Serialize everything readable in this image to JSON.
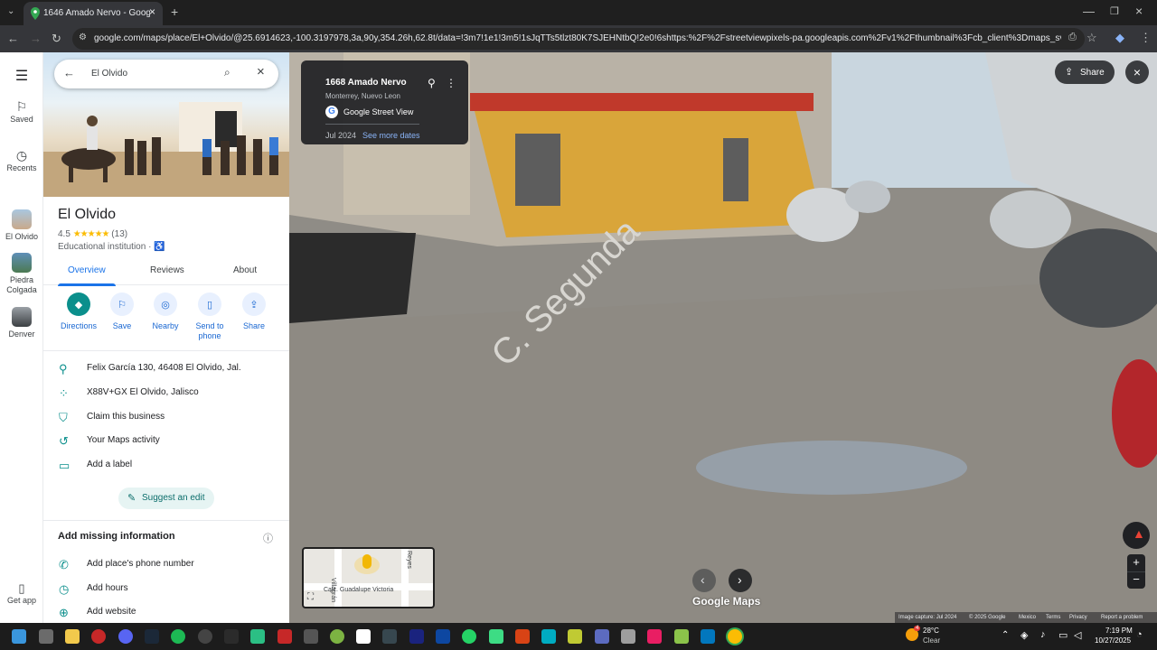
{
  "browser": {
    "tab_title": "1646 Amado Nervo - Google M",
    "url": "google.com/maps/place/El+Olvido/@25.6914623,-100.3197978,3a,90y,354.26h,62.8t/data=!3m7!1e1!3m5!1sJqTTs5tlzt80K7SJEHNtbQ!2e0!6shttps:%2F%2Fstreetviewpixels-pa.googleapis.com%2Fv1%2Fthumbnail%3Fcb_client%3Dmaps_sv.tactile%26w%3D900..."
  },
  "rail": {
    "saved_label": "Saved",
    "recents_label": "Recents",
    "recent_items": [
      "El Olvido",
      "Piedra Colgada",
      "Denver"
    ],
    "get_app_label": "Get app"
  },
  "panel": {
    "search_value": "El Olvido",
    "place_name": "El Olvido",
    "rating": "4.5",
    "stars": "★★★★★",
    "review_count": "(13)",
    "category": "Educational institution ·",
    "tabs": [
      "Overview",
      "Reviews",
      "About"
    ],
    "actions": [
      "Directions",
      "Save",
      "Nearby",
      "Send to phone",
      "Share"
    ],
    "info_rows": [
      "Felix García 130, 46408 El Olvido, Jal.",
      "X88V+GX El Olvido, Jalisco",
      "Claim this business",
      "Your Maps activity",
      "Add a label"
    ],
    "suggest_edit": "Suggest an edit",
    "missing_title": "Add missing information",
    "missing_rows": [
      "Add place's phone number",
      "Add hours",
      "Add website"
    ]
  },
  "streetview": {
    "title": "1668 Amado Nervo",
    "subtitle": "Monterrey, Nuevo Leon",
    "brand": "Google Street View",
    "capture_date": "Jul 2024",
    "see_more": "See more dates",
    "share_label": "Share",
    "logo": "Google Maps",
    "minimap_labels": [
      "Villagrán",
      "Calz. Guadalupe Victoria",
      "Reyes"
    ],
    "footer": [
      "Image capture: Jul 2024",
      "© 2025 Google",
      "Mexico",
      "Terms",
      "Privacy",
      "Report a problem"
    ]
  },
  "taskbar": {
    "temp": "28°C",
    "condition": "Clear",
    "time": "7:19 PM",
    "date": "10/27/2025",
    "weather_badge": "4"
  },
  "colors": {
    "accent": "#0b8f8c",
    "link": "#1a73e8",
    "star": "#fbbc04"
  }
}
